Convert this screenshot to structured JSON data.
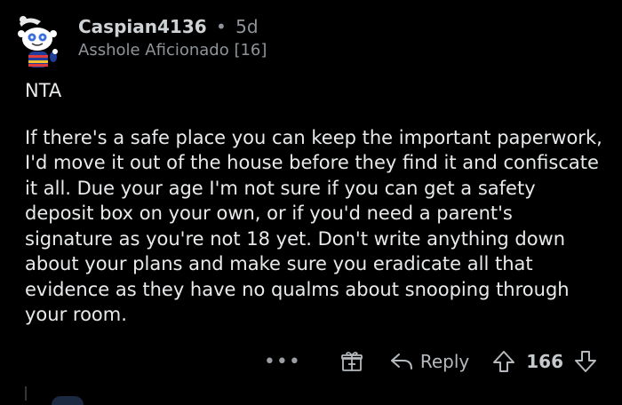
{
  "comment": {
    "username": "Caspian4136",
    "separator": "•",
    "age": "5d",
    "flair": "Asshole Aficionado [16]",
    "verdict": "NTA",
    "body": "If there's a safe place you can keep the important paperwork, I'd move it out of the house before they find it and confiscate it all. Due your age I'm not sure if you can get a safety deposit box on your own, or if you'd need a parent's signature as you're not 18 yet. Don't write anything down about your plans and make sure you eradicate all that evidence as they have no qualms about snooping through your room."
  },
  "actions": {
    "more_label": "•••",
    "reply_label": "Reply",
    "score": "166"
  },
  "icons": {
    "avatar": "snoo-avatar",
    "award": "gift-award-icon",
    "reply": "reply-arrow-icon",
    "upvote": "upvote-arrow-icon",
    "downvote": "downvote-arrow-icon"
  },
  "colors": {
    "background": "#000000",
    "text": "#e8eaec",
    "muted": "#8f9499",
    "actions": "#b6babe"
  }
}
